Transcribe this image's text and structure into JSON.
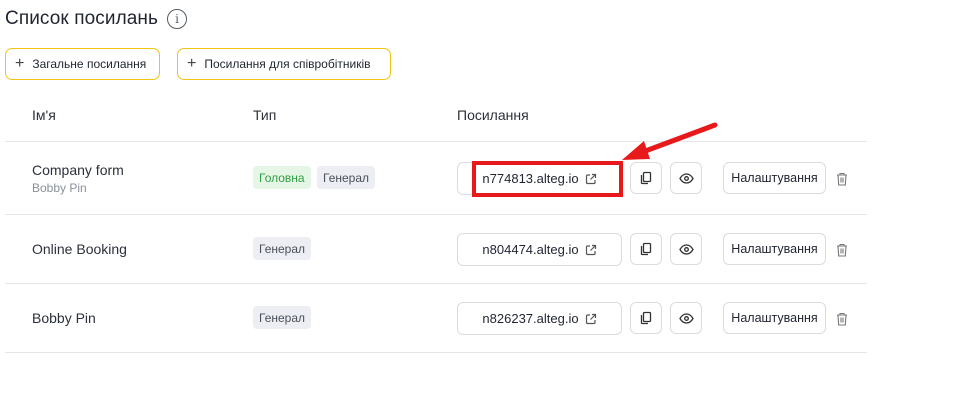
{
  "page": {
    "title": "Список посилань",
    "info_icon": "info-icon"
  },
  "actions": {
    "general_link_label": "Загальне посилання",
    "staff_link_label": "Посилання для співробітників"
  },
  "table": {
    "columns": [
      "Ім'я",
      "Тип",
      "Посилання"
    ],
    "settings_label": "Налаштування",
    "rows": [
      {
        "name": "Company form",
        "subtitle": "Bobby Pin",
        "badges": [
          "Головна",
          "Генерал"
        ],
        "link": "n774813.alteg.io"
      },
      {
        "name": "Online Booking",
        "subtitle": "",
        "badges": [
          "Генерал"
        ],
        "link": "n804474.alteg.io"
      },
      {
        "name": "Bobby Pin",
        "subtitle": "",
        "badges": [
          "Генерал"
        ],
        "link": "n826237.alteg.io"
      }
    ]
  },
  "colors": {
    "accent_border": "#f0c419",
    "annotation_red": "#e8191a",
    "badge_main_bg": "#e5f5e6",
    "badge_main_text": "#2f9e44"
  }
}
